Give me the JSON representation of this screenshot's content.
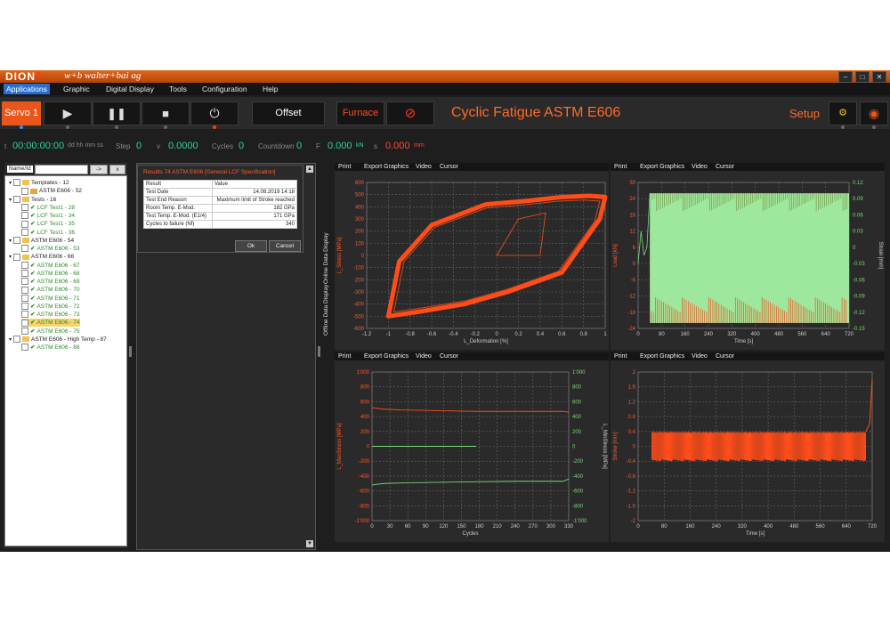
{
  "app": {
    "logo_text": "DION",
    "brand_text": "w+b walter+bai ag",
    "menu": [
      "Applications",
      "Graphic",
      "Digital Display",
      "Tools",
      "Configuration",
      "Help"
    ]
  },
  "toolbar": {
    "servo_label": "Servo 1",
    "offset_label": "Offset",
    "furnace_label": "Furnace",
    "test_title": "Cyclic Fatigue ASTM E606",
    "setup_label": "Setup"
  },
  "status": {
    "time_value": "00:00:00:00",
    "time_unit": "dd hh mm ss",
    "step_label": "Step",
    "step_value": "0",
    "v_label": "v",
    "v_value": "0.0000",
    "cycles_label": "Cycles",
    "cycles_value": "0",
    "countdown_label": "Countdown",
    "countdown_value": "0",
    "f_label": "F",
    "f_value": "0.000",
    "f_unit": "kN",
    "s_label": "s",
    "s_value": "0.000",
    "s_unit": "mm"
  },
  "tree": {
    "search_label": "Name/Id",
    "go_button": "->",
    "clear_button": "x",
    "items": [
      {
        "text": "Templates - 12",
        "type": "folder",
        "indent": 0
      },
      {
        "text": "ASTM E606 - 52",
        "type": "template",
        "indent": 1
      },
      {
        "text": "Tests - 16",
        "type": "folder",
        "indent": 0
      },
      {
        "text": "LCF Test1 - 28",
        "type": "test",
        "indent": 1
      },
      {
        "text": "LCF Test1 - 34",
        "type": "test",
        "indent": 1
      },
      {
        "text": "LCF Test1 - 35",
        "type": "test",
        "indent": 1
      },
      {
        "text": "LCF Test1 - 36",
        "type": "test",
        "indent": 1
      },
      {
        "text": "ASTM E606 - 54",
        "type": "folder",
        "indent": 0
      },
      {
        "text": "ASTM E606 - 53",
        "type": "test",
        "indent": 1
      },
      {
        "text": "ASTM E606 - 66",
        "type": "folder",
        "indent": 0
      },
      {
        "text": "ASTM E606 - 67",
        "type": "test",
        "indent": 1
      },
      {
        "text": "ASTM E606 - 68",
        "type": "test",
        "indent": 1
      },
      {
        "text": "ASTM E606 - 69",
        "type": "test",
        "indent": 1
      },
      {
        "text": "ASTM E606 - 70",
        "type": "test",
        "indent": 1
      },
      {
        "text": "ASTM E606 - 71",
        "type": "test",
        "indent": 1
      },
      {
        "text": "ASTM E606 - 72",
        "type": "test",
        "indent": 1
      },
      {
        "text": "ASTM E606 - 73",
        "type": "test",
        "indent": 1
      },
      {
        "text": "ASTM E606 - 74",
        "type": "test",
        "indent": 1,
        "selected": true
      },
      {
        "text": "ASTM E606 - 75",
        "type": "test",
        "indent": 1
      },
      {
        "text": "ASTM E606 - High Temp - 87",
        "type": "folder",
        "indent": 0
      },
      {
        "text": "ASTM E606 - 88",
        "type": "test",
        "indent": 1
      }
    ]
  },
  "results": {
    "title": "Results 74 ASTM E606 [General LCF Specification]",
    "col_result": "Result",
    "col_value": "Value",
    "rows": [
      {
        "result": "Test Date",
        "value": "14.08.2019 14:18"
      },
      {
        "result": "Test End Reason",
        "value": "Maximum limit of Stroke reached"
      },
      {
        "result": "Room Temp. E-Mod.",
        "value": "182 GPa"
      },
      {
        "result": "Test Temp. E-Mod. (E1/4)",
        "value": "171 GPa"
      },
      {
        "result": "Cycles to failure (Nf)",
        "value": "340"
      }
    ],
    "ok_label": "Ok",
    "cancel_label": "Cancel"
  },
  "side_tabs": [
    "Online Data Display",
    "Offline Data Display"
  ],
  "chart_toolbar": [
    "Print",
    "Export Graphics",
    "Video",
    "Cursor"
  ],
  "colors": {
    "series_orange": "#ff4d1a",
    "series_green": "#7ad67a",
    "fill_green": "#9ee89e",
    "accent": "#e8561c"
  },
  "chart_data": [
    {
      "type": "line",
      "xlabel": "L_Deformation [%]",
      "ylabel": "L_Stress [MPa]",
      "xlim": [
        -1.2,
        1
      ],
      "ylim": [
        -600,
        600
      ],
      "xticks": [
        "-1.2",
        "-1",
        "-0.8",
        "-0.6",
        "-0.4",
        "-0.2",
        "0",
        "0.2",
        "0.4",
        "0.6",
        "0.8",
        "1"
      ],
      "yticks": [
        "600",
        "500",
        "400",
        "300",
        "200",
        "100",
        "0",
        "-100",
        "-200",
        "-300",
        "-400",
        "-500",
        "-600"
      ],
      "series": [
        {
          "x": [
            -1.0,
            -0.7,
            -0.3,
            0.1,
            0.6,
            0.95,
            1.0,
            0.85,
            0.6,
            0.3,
            -0.1,
            -0.6,
            -0.9,
            -1.0
          ],
          "y": [
            -500,
            -460,
            -400,
            -300,
            -140,
            300,
            480,
            490,
            480,
            450,
            420,
            250,
            -50,
            -500
          ]
        }
      ]
    },
    {
      "type": "line",
      "xlabel": "Time [s]",
      "ylabel": "Load [kN]",
      "y2label": "Strain [mm]",
      "xlim": [
        0,
        720
      ],
      "ylim": [
        -24,
        30
      ],
      "xticks": [
        "0",
        "80",
        "160",
        "240",
        "320",
        "400",
        "480",
        "560",
        "640",
        "720"
      ],
      "yticks": [
        "30",
        "24",
        "18",
        "12",
        "6",
        "0",
        "-6",
        "-12",
        "-18",
        "-24"
      ],
      "y2ticks": [
        "0.12",
        "0.09",
        "0.06",
        "0.03",
        "0",
        "-0.03",
        "-0.06",
        "-0.09",
        "-0.12",
        "-0.15"
      ],
      "series": [
        {
          "x": [
            0,
            40,
            80,
            720
          ],
          "y": [
            26,
            -22,
            26,
            -22
          ]
        }
      ]
    },
    {
      "type": "line",
      "xlabel": "Cycles",
      "ylabel": "L_MaxStress [MPa]",
      "y2label": "L_MinStress [MPa]",
      "xlim": [
        0,
        340
      ],
      "ylim": [
        -1000,
        1000
      ],
      "xticks": [
        "0",
        "30",
        "60",
        "90",
        "120",
        "150",
        "180",
        "210",
        "240",
        "270",
        "300",
        "330"
      ],
      "yticks": [
        "1'000",
        "800",
        "600",
        "400",
        "200",
        "0",
        "-200",
        "-400",
        "-600",
        "-800",
        "-1'000"
      ],
      "y2ticks": [
        "1'000",
        "800",
        "600",
        "400",
        "200",
        "0",
        "-200",
        "-400",
        "-600",
        "-800",
        "-1'000"
      ],
      "series": [
        {
          "x": [
            0,
            20,
            50,
            120,
            180,
            330,
            340
          ],
          "y": [
            520,
            500,
            490,
            480,
            470,
            470,
            460
          ]
        },
        {
          "x": [
            0,
            180
          ],
          "y": [
            0,
            0
          ]
        },
        {
          "x": [
            0,
            20,
            60,
            150,
            250,
            330,
            340
          ],
          "y": [
            -520,
            -500,
            -490,
            -480,
            -470,
            -470,
            -440
          ]
        }
      ]
    },
    {
      "type": "line",
      "xlabel": "Time [s]",
      "ylabel": "Stroke [mm]",
      "xlim": [
        0,
        720
      ],
      "ylim": [
        -2,
        2
      ],
      "xticks": [
        "0",
        "80",
        "160",
        "240",
        "320",
        "400",
        "480",
        "560",
        "640",
        "720"
      ],
      "yticks": [
        "2",
        "1.6",
        "1.2",
        "0.8",
        "0.4",
        "0",
        "-0.4",
        "-0.8",
        "-1.2",
        "-1.6",
        "-2"
      ],
      "series": [
        {
          "x": [
            40,
            700,
            710,
            720
          ],
          "y": [
            0.4,
            -0.4,
            0.4,
            1.8
          ]
        }
      ]
    }
  ]
}
